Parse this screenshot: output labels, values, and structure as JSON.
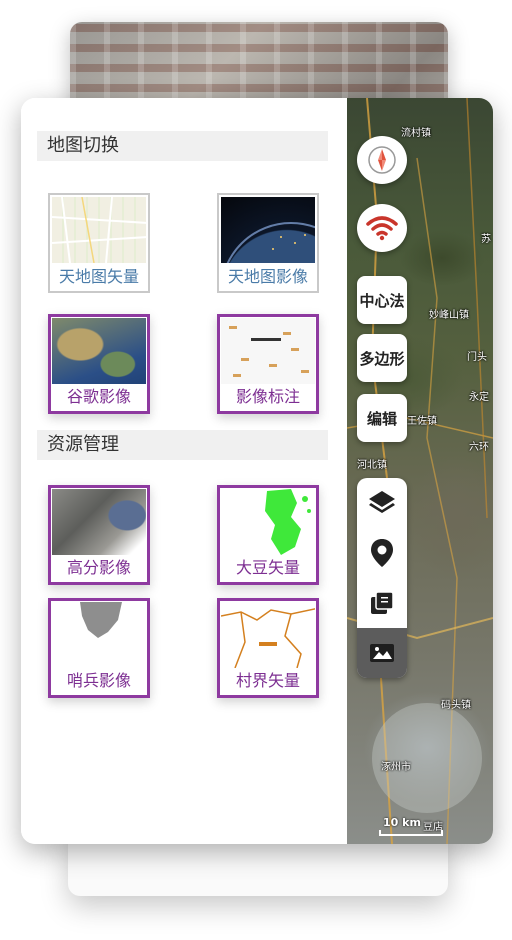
{
  "panel": {
    "section1_title": "地图切换",
    "section2_title": "资源管理",
    "basemaps": [
      {
        "label": "天地图矢量",
        "icon": "vector-map-thumbnail",
        "selected": false
      },
      {
        "label": "天地图影像",
        "icon": "earth-night-thumbnail",
        "selected": false
      },
      {
        "label": "谷歌影像",
        "icon": "satellite-thumbnail",
        "selected": true
      },
      {
        "label": "影像标注",
        "icon": "annotation-thumbnail",
        "selected": true
      }
    ],
    "resources": [
      {
        "label": "高分影像",
        "icon": "gaofen-image-thumbnail"
      },
      {
        "label": "大豆矢量",
        "icon": "soybean-vector-thumbnail"
      },
      {
        "label": "哨兵影像",
        "icon": "sentinel-image-thumbnail"
      },
      {
        "label": "村界矢量",
        "icon": "village-boundary-thumbnail"
      }
    ]
  },
  "toolbar": {
    "compass": "compass-icon",
    "wifi": "wifi-icon",
    "center_method": "中心法",
    "polygon": "多边形",
    "edit": "编辑",
    "stack_icons": [
      "layers-icon",
      "location-pin-icon",
      "layer-list-icon",
      "image-gallery-icon"
    ]
  },
  "map": {
    "place_labels": [
      "流村镇",
      "苏",
      "妙峰山镇",
      "门头",
      "永定",
      "王佐镇",
      "河北镇",
      "六环",
      "码头镇",
      "涿州市",
      "豆店"
    ],
    "scale": "10 km"
  },
  "colors": {
    "accent_purple": "#8e3aa0",
    "label_blue": "#4a7ba8",
    "wifi_red": "#c9352b"
  }
}
